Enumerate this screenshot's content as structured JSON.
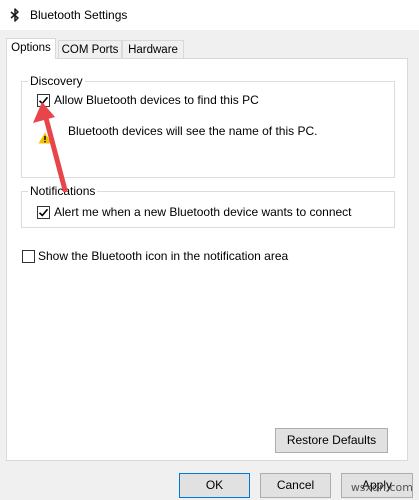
{
  "window": {
    "title": "Bluetooth Settings",
    "icon": "bluetooth-icon"
  },
  "tabs": [
    {
      "label": "Options",
      "active": true
    },
    {
      "label": "COM Ports",
      "active": false
    },
    {
      "label": "Hardware",
      "active": false
    }
  ],
  "discovery": {
    "title": "Discovery",
    "allow_label": "Allow Bluetooth devices to find this PC",
    "allow_checked": true,
    "note": "Bluetooth devices will see the name of this PC.",
    "note_icon": "warning-icon"
  },
  "notifications": {
    "title": "Notifications",
    "alert_label": "Alert me when a new Bluetooth device wants to connect",
    "alert_checked": true
  },
  "show_icon": {
    "label": "Show the Bluetooth icon in the notification area",
    "checked": false
  },
  "buttons": {
    "restore_defaults": "Restore Defaults",
    "ok": "OK",
    "cancel": "Cancel",
    "apply": "Apply"
  },
  "annotation": {
    "arrow_color": "#e8454a"
  },
  "watermark": "wsxdn.com"
}
